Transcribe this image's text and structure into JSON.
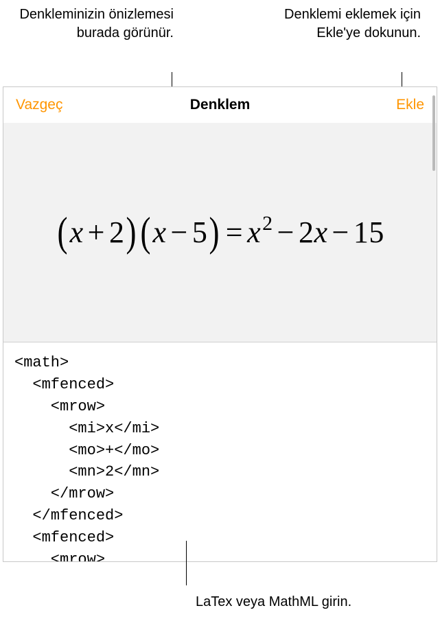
{
  "callouts": {
    "previewLabel": "Denkleminizin önizlemesi burada görünür.",
    "insertLabel": "Denklemi eklemek için Ekle'ye dokunun.",
    "inputLabel": "LaTex veya MathML girin."
  },
  "dialog": {
    "cancel": "Vazgeç",
    "title": "Denklem",
    "insert": "Ekle"
  },
  "equation": {
    "lparen1": "(",
    "x1": "x",
    "plus1": "+",
    "two": "2",
    "rparen1": ")",
    "lparen2": "(",
    "x2": "x",
    "minus1": "−",
    "five": "5",
    "rparen2": ")",
    "eq": "=",
    "x3": "x",
    "sq": "2",
    "minus2": "−",
    "coef": "2",
    "x4": "x",
    "minus3": "−",
    "fifteen": "15"
  },
  "code": "<math>\n  <mfenced>\n    <mrow>\n      <mi>x</mi>\n      <mo>+</mo>\n      <mn>2</mn>\n    </mrow>\n  </mfenced>\n  <mfenced>\n    <mrow>"
}
